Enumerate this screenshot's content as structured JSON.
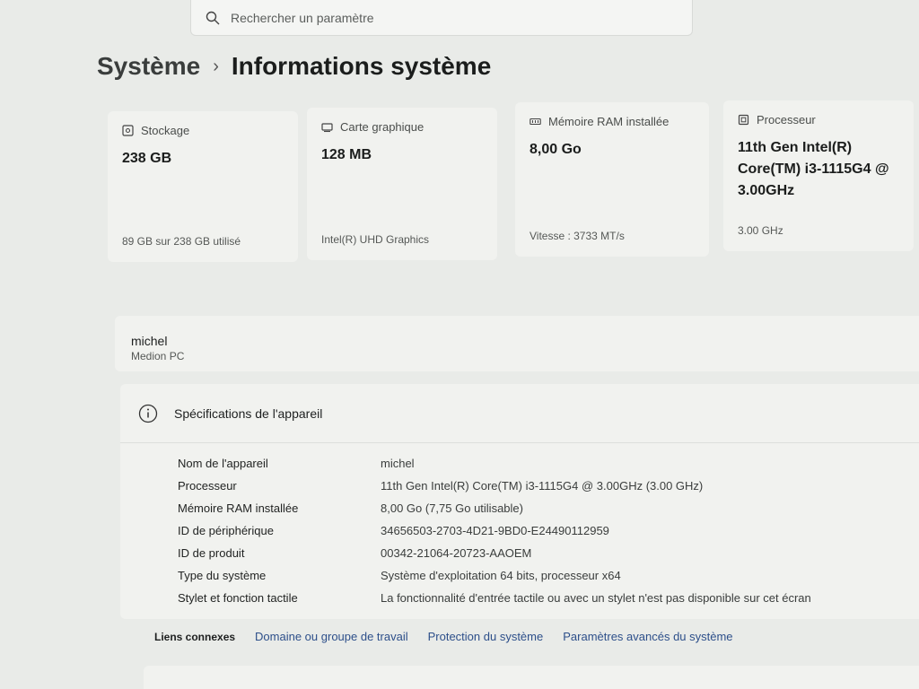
{
  "search": {
    "placeholder": "Rechercher un paramètre"
  },
  "breadcrumb": {
    "parent": "Système",
    "separator": "›",
    "current": "Informations système"
  },
  "cards": {
    "storage": {
      "label": "Stockage",
      "value": "238 GB",
      "sub": "89 GB sur 238 GB utilisé"
    },
    "gpu": {
      "label": "Carte graphique",
      "value": "128 MB",
      "sub": "Intel(R) UHD Graphics"
    },
    "ram": {
      "label": "Mémoire RAM installée",
      "value": "8,00 Go",
      "sub": "Vitesse : 3733 MT/s"
    },
    "cpu": {
      "label": "Processeur",
      "value": "11th Gen Intel(R) Core(TM) i3-1115G4 @ 3.00GHz",
      "sub": "3.00 GHz"
    }
  },
  "device": {
    "name": "michel",
    "model": "Medion PC"
  },
  "specs": {
    "title": "Spécifications de l'appareil",
    "rows": [
      {
        "label": "Nom de l'appareil",
        "value": "michel"
      },
      {
        "label": "Processeur",
        "value": "11th Gen Intel(R) Core(TM) i3-1115G4 @ 3.00GHz (3.00 GHz)"
      },
      {
        "label": "Mémoire RAM installée",
        "value": "8,00 Go (7,75 Go utilisable)"
      },
      {
        "label": "ID de périphérique",
        "value": "34656503-2703-4D21-9BD0-E24490112959"
      },
      {
        "label": "ID de produit",
        "value": "00342-21064-20723-AAOEM"
      },
      {
        "label": "Type du système",
        "value": "Système d'exploitation 64 bits, processeur x64"
      },
      {
        "label": "Stylet et fonction tactile",
        "value": "La fonctionnalité d'entrée tactile ou avec un stylet n'est pas disponible sur cet écran"
      }
    ]
  },
  "related": {
    "label": "Liens connexes",
    "links": [
      "Domaine ou groupe de travail",
      "Protection du système",
      "Paramètres avancés du système"
    ]
  },
  "colors": {
    "background": "#e9ebe8",
    "card": "#f1f2ef",
    "link": "#2d4f8a"
  }
}
